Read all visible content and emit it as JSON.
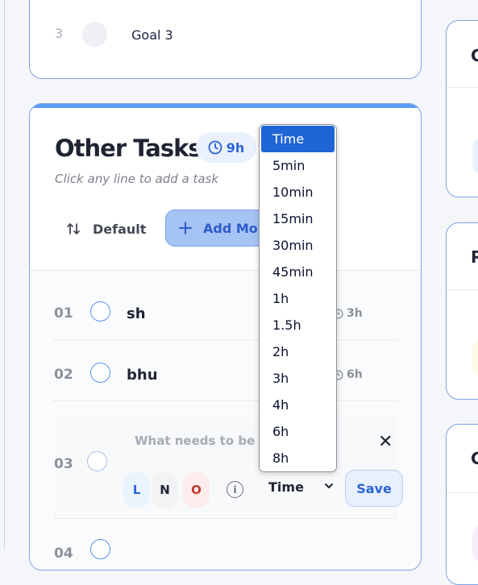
{
  "goals": {
    "number": "3",
    "label": "Goal 3"
  },
  "other_tasks": {
    "title": "Other Tasks",
    "time_badge": "9h",
    "subtitle": "Click any line to add a task",
    "sort_label": "Default",
    "add_label": "Add More"
  },
  "tasks": [
    {
      "num": "01",
      "label": "sh",
      "time": "3h"
    },
    {
      "num": "02",
      "label": "bhu",
      "time": "6h"
    },
    {
      "num": "03"
    },
    {
      "num": "04"
    }
  ],
  "editor": {
    "placeholder": "What needs to be done?",
    "pills": [
      "L",
      "N",
      "O"
    ],
    "info_icon": "i",
    "time_value": "Time",
    "save_label": "Save"
  },
  "dropdown": {
    "options": [
      "Time",
      "5min",
      "10min",
      "15min",
      "30min",
      "45min",
      "1h",
      "1.5h",
      "2h",
      "3h",
      "4h",
      "6h",
      "8h"
    ],
    "selected": "Time"
  },
  "right_panel": {
    "letters": [
      "G",
      "R",
      "G"
    ]
  },
  "colors": {
    "accent": "#5b9cf4",
    "primary": "#2c64d6",
    "select_highlight": "#1f65d6"
  }
}
